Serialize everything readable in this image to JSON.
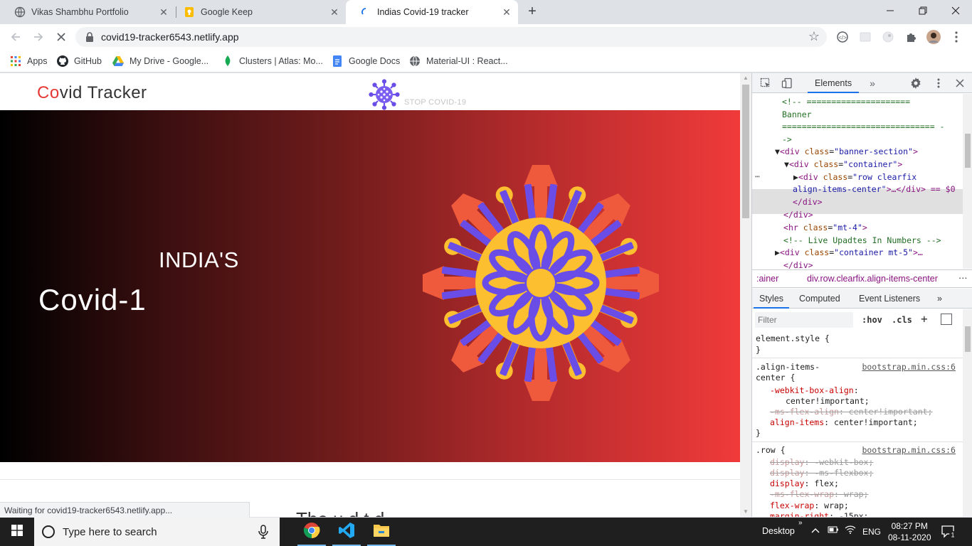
{
  "browser": {
    "tabs": [
      {
        "title": "Vikas Shambhu Portfolio",
        "icon": "globe-icon"
      },
      {
        "title": "Google Keep",
        "icon": "google-keep-icon"
      },
      {
        "title": "Indias Covid-19 tracker",
        "icon": "loading-icon",
        "active": true
      }
    ],
    "url": "covid19-tracker6543.netlify.app",
    "bookmarks": [
      {
        "label": "Apps",
        "icon": "apps-grid-icon"
      },
      {
        "label": "GitHub",
        "icon": "github-icon"
      },
      {
        "label": "My Drive - Google...",
        "icon": "google-drive-icon"
      },
      {
        "label": "Clusters | Atlas: Mo...",
        "icon": "mongodb-leaf-icon"
      },
      {
        "label": "Google Docs",
        "icon": "google-docs-icon"
      },
      {
        "label": "Material-UI : React...",
        "icon": "globe-icon"
      }
    ],
    "status_text": "Waiting for covid19-tracker6543.netlify.app..."
  },
  "site": {
    "brand_first": "Co",
    "brand_rest": "vid Tracker",
    "stop_text": "STOP COVID-19",
    "banner_subtitle": "INDIA'S",
    "banner_title": "Covid-1",
    "next_heading": "The  u  d  t  d  "
  },
  "devtools": {
    "active_tab": "Elements",
    "dom": [
      {
        "type": "comment",
        "text": "<!--  ====================="
      },
      {
        "type": "comment",
        "text": "Banner"
      },
      {
        "type": "comment",
        "text": "=============================== -"
      },
      {
        "type": "comment",
        "text": "->"
      },
      {
        "type": "open",
        "tag": "div",
        "attr": "class",
        "value": "banner-section",
        "arrow": "▼"
      },
      {
        "type": "open",
        "tag": "div",
        "attr": "class",
        "value": "container",
        "arrow": "▼"
      },
      {
        "type": "selected",
        "tag": "div",
        "attr": "class",
        "value": "row clearfix",
        "value2": "align-items-center",
        "suffix": ">…</div> == $0"
      },
      {
        "type": "close",
        "text": "</div>"
      },
      {
        "type": "close",
        "text": "</div>"
      },
      {
        "type": "open",
        "tag": "hr",
        "attr": "class",
        "value": "mt-4"
      },
      {
        "type": "comment",
        "text": "<!-- Live Upadtes In Numbers -->"
      },
      {
        "type": "open",
        "tag": "div",
        "attr": "class",
        "value": "container mt-5",
        "arrow": "▶",
        "suffix": ">…"
      },
      {
        "type": "close",
        "text": "</div>"
      }
    ],
    "breadcrumb": [
      ":ainer",
      "div.row.clearfix.align-items-center"
    ],
    "styles_tabs": [
      "Styles",
      "Computed",
      "Event Listeners"
    ],
    "filter_placeholder": "Filter",
    "hov": ":hov",
    "cls": ".cls",
    "styles": {
      "element_style": "element.style {",
      "element_close": "}",
      "rule1_selector_a": ".align-items-",
      "rule1_selector_b": "center {",
      "rule1_source": "bootstrap.min.css:6",
      "rule1_decls": [
        {
          "prop": "-webkit-box-align",
          "value": ":",
          "struck": false
        },
        {
          "prop": "",
          "value": "center!important;",
          "struck": false
        },
        {
          "prop": "-ms-flex-align",
          "value": ": center!important;",
          "struck": true
        },
        {
          "prop": "align-items",
          "value": ": center!important;",
          "struck": false
        }
      ],
      "rule1_close": "}",
      "rule2_selector": ".row {",
      "rule2_source": "bootstrap.min.css:6",
      "rule2_decls": [
        {
          "prop": "display",
          "value": ": -webkit-box;",
          "struck": true
        },
        {
          "prop": "display",
          "value": ": -ms-flexbox;",
          "struck": true
        },
        {
          "prop": "display",
          "value": ": flex;",
          "struck": false
        },
        {
          "prop": "-ms-flex-wrap",
          "value": ": wrap;",
          "struck": true
        },
        {
          "prop": "flex-wrap",
          "value": ": wrap;",
          "struck": false
        },
        {
          "prop": "margin-right",
          "value": ": -15px;",
          "struck": false
        }
      ]
    }
  },
  "taskbar": {
    "search_placeholder": "Type here to search",
    "desktop_label": "Desktop",
    "language": "ENG",
    "time": "08:27 PM",
    "date": "08-11-2020",
    "notification_count": "1"
  },
  "colors": {
    "brand_accent": "#e53935",
    "banner_start": "#000000",
    "banner_end": "#f03a3a",
    "virus_orange": "#f05a3c",
    "virus_yellow": "#fbbf2f",
    "virus_purple": "#6a4de6"
  }
}
